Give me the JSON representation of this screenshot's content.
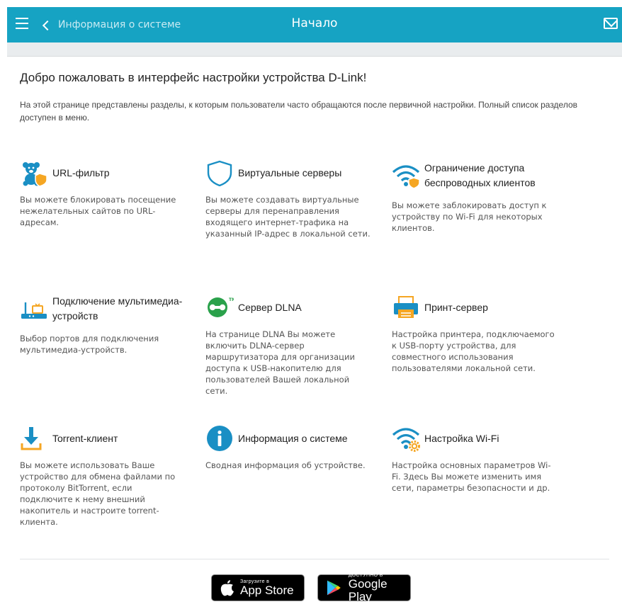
{
  "header": {
    "back_label": "Информация о системе",
    "title": "Начало"
  },
  "welcome": {
    "heading": "Добро пожаловать в интерфейс настройки устройства D-Link!",
    "intro": "На этой странице представлены разделы, к которым пользователи часто обращаются после первичной настройки. Полный список разделов доступен в меню."
  },
  "cards": [
    {
      "title": "URL-фильтр",
      "desc": "Вы можете блокировать посещение нежелательных сайтов по URL-адресам.",
      "icon": "teddy-bear-shield-icon"
    },
    {
      "title": "Виртуальные серверы",
      "desc": "Вы можете создавать виртуальные серверы для перенаправления входящего интернет-трафика на указанный IP-адрес в локальной сети.",
      "icon": "shield-icon"
    },
    {
      "title": "Ограничение доступа беспроводных клиентов",
      "desc": "Вы можете заблокировать доступ к устройству по Wi-Fi для некоторых клиентов.",
      "icon": "wifi-shield-icon"
    },
    {
      "title": "Подключение мультимедиа-устройств",
      "desc": "Выбор портов для подключения мультимедиа-устройств.",
      "icon": "router-tv-icon"
    },
    {
      "title": "Сервер DLNA",
      "desc": "На странице DLNA Вы можете включить DLNA-сервер маршрутизатора для организации доступа к USB-накопителю для пользователей Вашей локальной сети.",
      "icon": "dlna-icon"
    },
    {
      "title": "Принт-сервер",
      "desc": "Настройка принтера, подключаемого к USB-порту устройства, для совместного использования пользователями локальной сети.",
      "icon": "printer-icon"
    },
    {
      "title": "Torrent-клиент",
      "desc": "Вы можете использовать Ваше устройство для обмена файлами по протоколу BitTorrent, если подключите к нему внешний накопитель и настроите torrent-клиента.",
      "icon": "download-icon"
    },
    {
      "title": "Информация о системе",
      "desc": "Сводная информация об устройстве.",
      "icon": "info-icon"
    },
    {
      "title": "Настройка Wi-Fi",
      "desc": "Настройка основных параметров Wi-Fi. Здесь Вы можете изменить имя сети, параметры безопасности и др.",
      "icon": "wifi-gear-icon"
    }
  ],
  "stores": {
    "appstore_small": "Загрузите в",
    "appstore_big": "App Store",
    "googleplay_small": "ДОСТУПНО В",
    "googleplay_big": "Google Play"
  },
  "colors": {
    "header_bg": "#16a3c3",
    "accent_blue": "#1a8fc4",
    "accent_orange": "#f5a623"
  }
}
